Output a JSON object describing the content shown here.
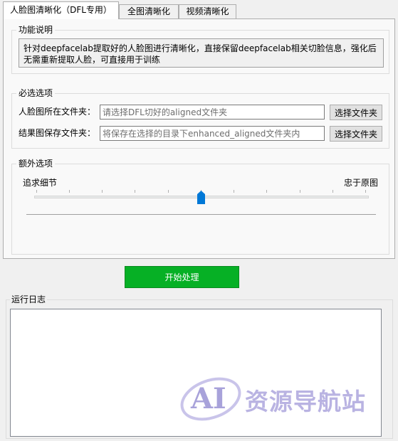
{
  "tabs": [
    {
      "label": "人脸图清晰化（DFL专用）",
      "active": true
    },
    {
      "label": "全图清晰化",
      "active": false
    },
    {
      "label": "视频清晰化",
      "active": false
    }
  ],
  "description": {
    "title": "功能说明",
    "text": "针对deepfacelab提取好的人脸图进行清晰化，直接保留deepfacelab相关切脸信息，强化后无需重新提取人脸，可直接用于训练"
  },
  "required": {
    "title": "必选选项",
    "input_folder": {
      "label": "人脸图所在文件夹：",
      "placeholder": "请选择DFL切好的aligned文件夹",
      "button": "选择文件夹"
    },
    "output_folder": {
      "label": "结果图保存文件夹：",
      "placeholder": "将保存在选择的目录下enhanced_aligned文件夹内",
      "button": "选择文件夹"
    }
  },
  "extra": {
    "title": "额外选项",
    "left_label": "追求细节",
    "right_label": "忠于原图",
    "slider_value": 0.5
  },
  "start_button": "开始处理",
  "log": {
    "title": "运行日志",
    "content": ""
  },
  "watermark": {
    "brand": "AI",
    "text": "资源导航站"
  },
  "colors": {
    "accent": "#0078d7",
    "start_button": "#06b025"
  }
}
